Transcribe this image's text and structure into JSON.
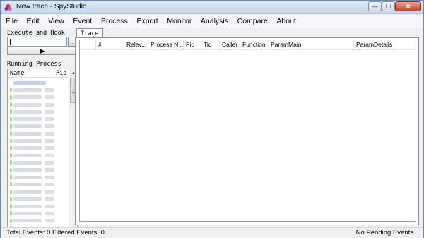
{
  "window": {
    "title": "New trace - SpyStudio",
    "min_glyph": "—",
    "max_glyph": "☐",
    "close_glyph": "✕"
  },
  "menu": [
    "File",
    "Edit",
    "View",
    "Event",
    "Process",
    "Export",
    "Monitor",
    "Analysis",
    "Compare",
    "About"
  ],
  "execute": {
    "label": "Execute and Hook",
    "input_value": "",
    "browse_label": ".",
    "run_glyph": "▶"
  },
  "running": {
    "label": "Running Process",
    "columns": [
      "Name",
      "Pid"
    ]
  },
  "trace": {
    "tab_label": "Trace",
    "columns": [
      "#",
      "Relev...",
      "Process N...",
      "Pid",
      "Tid",
      "Caller",
      "Function",
      "ParamMain",
      "ParamDetails"
    ]
  },
  "status": {
    "left": "Total Events: 0  Filtered Events: 0",
    "right": "No Pending Events"
  },
  "icons": {
    "app": "spystudio-app-icon",
    "run": "play-icon",
    "up": "scroll-up-icon",
    "down": "scroll-down-icon"
  }
}
